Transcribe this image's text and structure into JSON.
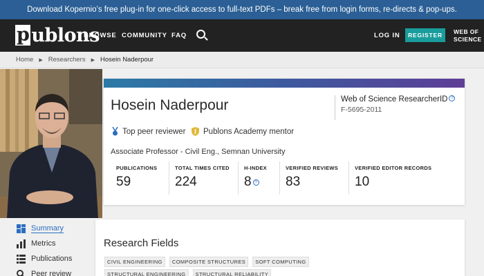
{
  "banner": {
    "text": "Download Kopernio’s free plug-in for one-click access to full-text PDFs – break free from login forms, re-directs & pop-ups."
  },
  "nav": {
    "logo": "publons",
    "browse": "BROWSE",
    "community": "COMMUNITY",
    "faq": "FAQ",
    "login": "LOG IN",
    "register": "REGISTER",
    "wos_line1": "WEB OF",
    "wos_line2": "SCIENCE"
  },
  "breadcrumb": [
    "Home",
    "Researchers",
    "Hosein Naderpour"
  ],
  "profile": {
    "name": "Hosein Naderpour",
    "rid_title": "Web of Science ResearcherID",
    "rid_value": "F-5695-2011",
    "awards": [
      "Top peer reviewer",
      "Publons Academy mentor"
    ],
    "position": "Associate Professor - Civil Eng., Semnan University",
    "metrics": [
      {
        "label": "PUBLICATIONS",
        "value": "59"
      },
      {
        "label": "TOTAL TIMES CITED",
        "value": "224"
      },
      {
        "label": "H-INDEX",
        "value": "8"
      },
      {
        "label": "VERIFIED REVIEWS",
        "value": "83"
      },
      {
        "label": "VERIFIED EDITOR RECORDS",
        "value": "10"
      }
    ]
  },
  "sidebar": {
    "items": [
      {
        "label": "Summary",
        "icon": "grid-icon"
      },
      {
        "label": "Metrics",
        "icon": "bar-chart-icon"
      },
      {
        "label": "Publications",
        "icon": "list-icon"
      },
      {
        "label": "Peer review",
        "icon": "search-icon"
      }
    ]
  },
  "research": {
    "title": "Research Fields",
    "tags": [
      "CIVIL ENGINEERING",
      "COMPOSITE STRUCTURES",
      "SOFT COMPUTING",
      "STRUCTURAL ENGINEERING",
      "STRUCTURAL RELIABILITY"
    ]
  },
  "colors": {
    "banner": "#2b5f95",
    "nav": "#222222",
    "register": "#1a9c9c",
    "link": "#2b6dbf"
  }
}
